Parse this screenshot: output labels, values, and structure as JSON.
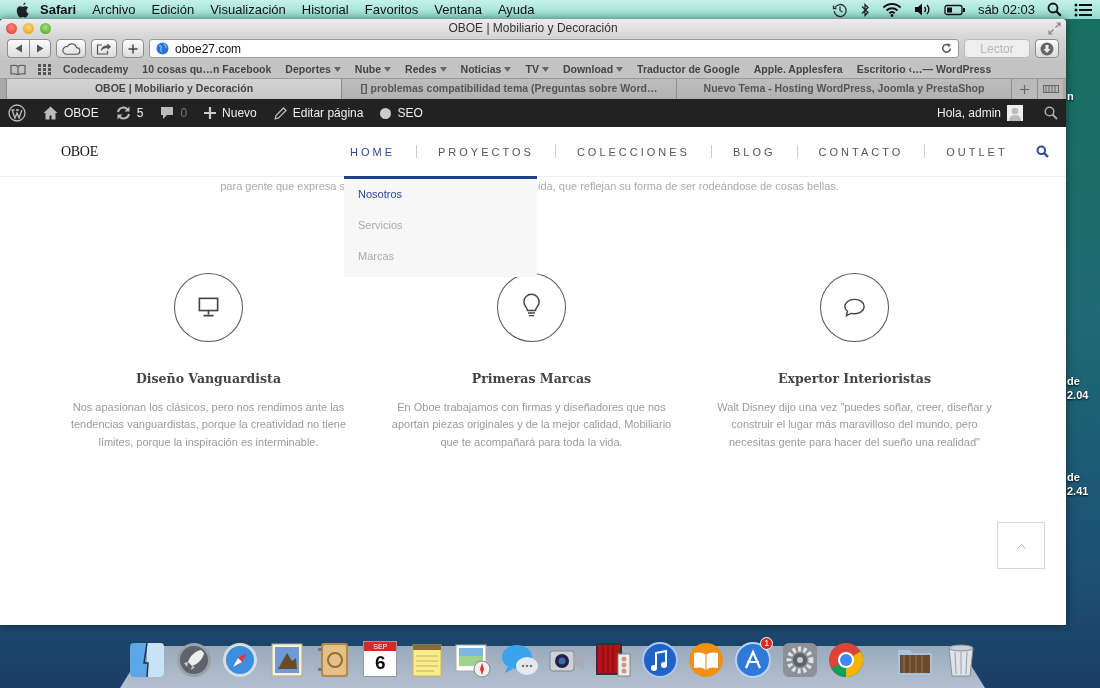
{
  "menubar": {
    "app": "Safari",
    "menus": [
      "Archivo",
      "Edición",
      "Visualización",
      "Historial",
      "Favoritos",
      "Ventana",
      "Ayuda"
    ],
    "clock": "sáb 02:03"
  },
  "window": {
    "title": "OBOE | Mobiliario y Decoración"
  },
  "toolbar": {
    "url": "oboe27.com",
    "reader": "Lector",
    "reader_disabled": true
  },
  "bookmarks": [
    {
      "label": "Codecademy",
      "menu": false
    },
    {
      "label": "10 cosas qu…n Facebook",
      "menu": false
    },
    {
      "label": "Deportes",
      "menu": true
    },
    {
      "label": "Nube",
      "menu": true
    },
    {
      "label": "Redes",
      "menu": true
    },
    {
      "label": "Noticias",
      "menu": true
    },
    {
      "label": "TV",
      "menu": true
    },
    {
      "label": "Download",
      "menu": true
    },
    {
      "label": "Traductor de Google",
      "menu": false
    },
    {
      "label": "Apple. Applesfera",
      "menu": false
    },
    {
      "label": "Escritorio ‹…— WordPress",
      "menu": false
    }
  ],
  "tabs": [
    {
      "label": "OBOE | Mobiliario y Decoración",
      "selected": true
    },
    {
      "label": "[] problemas compatibilidad tema (Preguntas sobre Word…",
      "selected": false
    },
    {
      "label": "Nuevo Tema - Hosting WordPress, Joomla y PrestaShop",
      "selected": false
    }
  ],
  "admin_bar": {
    "items": [
      {
        "kind": "wordpress"
      },
      {
        "kind": "home",
        "label": "OBOE"
      },
      {
        "kind": "updates",
        "label": "5"
      },
      {
        "kind": "comments",
        "label": "0"
      },
      {
        "kind": "new",
        "label": "Nuevo"
      },
      {
        "kind": "edit",
        "label": "Editar página"
      },
      {
        "kind": "seo",
        "label": "SEO"
      }
    ],
    "greeting": "Hola, admin"
  },
  "site": {
    "logo": "OBOE",
    "nav": [
      {
        "label": "HOME",
        "selected": true
      },
      {
        "label": "PROYECTOS",
        "selected": false
      },
      {
        "label": "COLECCIONES",
        "selected": false
      },
      {
        "label": "BLOG",
        "selected": false
      },
      {
        "label": "CONTACTO",
        "selected": false
      },
      {
        "label": "OUTLET",
        "selected": false
      }
    ],
    "dropdown": [
      {
        "label": "Nosotros",
        "selected": true
      },
      {
        "label": "Servicios",
        "selected": false
      },
      {
        "label": "Marcas",
        "selected": false
      }
    ],
    "intro_fragments": [
      "para gente que expresa s",
      "ida, que reflejan su forma de ser rodeándose de cosas bellas."
    ],
    "features": [
      {
        "kind": "monitor",
        "title": "Diseño Vanguardista",
        "text": "Nos apasionan los clásicos, pero nos rendimos ante las tendencias vanguardistas, porque la creatividad no tiene límites, porque la inspiración es interminable."
      },
      {
        "kind": "bulb",
        "title": "Primeras Marcas",
        "text": "En Oboe trabajamos con firmas y diseñadores que nos aportan piezas originales y de la mejor calidad. Mobiliario que te acompañará para toda la vida."
      },
      {
        "kind": "chat",
        "title": "Expertor Interioristas",
        "text": "Walt Disney dijo una vez \"puedes soñar, creer, diseñar y construir el lugar más maravilloso del mundo, pero necesitas gente para hacer del sueño una realidad\""
      }
    ]
  },
  "desktop_labels": [
    "n",
    "de",
    "2.04",
    "de",
    "2.41"
  ],
  "dock": [
    {
      "kind": "finder"
    },
    {
      "kind": "launchpad"
    },
    {
      "kind": "safari"
    },
    {
      "kind": "mail"
    },
    {
      "kind": "contacts"
    },
    {
      "kind": "calendar",
      "month": "SEP",
      "day": "6"
    },
    {
      "kind": "notes"
    },
    {
      "kind": "preview"
    },
    {
      "kind": "messages"
    },
    {
      "kind": "facetime"
    },
    {
      "kind": "photobooth"
    },
    {
      "kind": "itunes"
    },
    {
      "kind": "ibooks"
    },
    {
      "kind": "appstore",
      "badge": "1"
    },
    {
      "kind": "prefs"
    },
    {
      "kind": "chrome"
    },
    {
      "kind": "separator"
    },
    {
      "kind": "folder"
    },
    {
      "kind": "trash"
    }
  ]
}
